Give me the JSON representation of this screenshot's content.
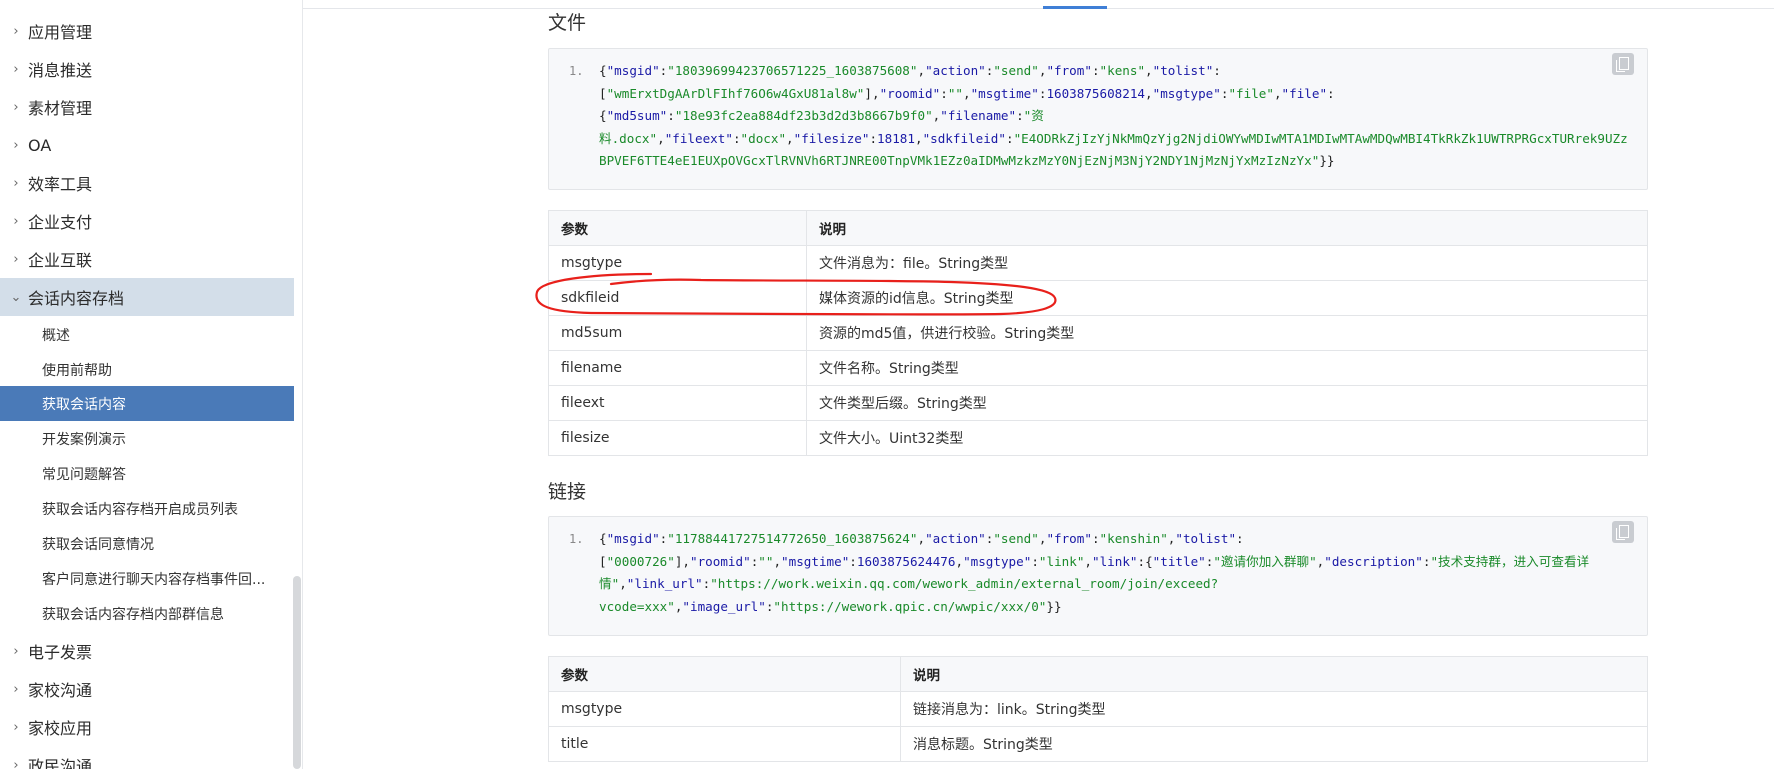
{
  "sidebar": {
    "top_items": [
      {
        "label": "应用管理"
      },
      {
        "label": "消息推送"
      },
      {
        "label": "素材管理"
      },
      {
        "label": "OA"
      },
      {
        "label": "效率工具"
      },
      {
        "label": "企业支付"
      },
      {
        "label": "企业互联"
      }
    ],
    "expanded_item": {
      "label": "会话内容存档"
    },
    "sub_items": [
      {
        "label": "概述"
      },
      {
        "label": "使用前帮助"
      },
      {
        "label": "获取会话内容"
      },
      {
        "label": "开发案例演示"
      },
      {
        "label": "常见问题解答"
      },
      {
        "label": "获取会话内容存档开启成员列表"
      },
      {
        "label": "获取会话同意情况"
      },
      {
        "label": "客户同意进行聊天内容存档事件回..."
      },
      {
        "label": "获取会话内容存档内部群信息"
      }
    ],
    "bottom_items": [
      {
        "label": "电子发票"
      },
      {
        "label": "家校沟通"
      },
      {
        "label": "家校应用"
      },
      {
        "label": "政民沟通"
      }
    ]
  },
  "file_section": {
    "title": "文件",
    "line_number": "1.",
    "code_segments": [
      {
        "t": "{",
        "c": "p"
      },
      {
        "t": "\"msgid\"",
        "c": "k"
      },
      {
        "t": ":",
        "c": "p"
      },
      {
        "t": "\"18039699423706571225_1603875608\"",
        "c": "s"
      },
      {
        "t": ",",
        "c": "p"
      },
      {
        "t": "\"action\"",
        "c": "k"
      },
      {
        "t": ":",
        "c": "p"
      },
      {
        "t": "\"send\"",
        "c": "s"
      },
      {
        "t": ",",
        "c": "p"
      },
      {
        "t": "\"from\"",
        "c": "k"
      },
      {
        "t": ":",
        "c": "p"
      },
      {
        "t": "\"kens\"",
        "c": "s"
      },
      {
        "t": ",",
        "c": "p"
      },
      {
        "t": "\"tolist\"",
        "c": "k"
      },
      {
        "t": ":\n[",
        "c": "p"
      },
      {
        "t": "\"wmErxtDgAArDlFIhf76O6w4GxU81al8w\"",
        "c": "s"
      },
      {
        "t": "],",
        "c": "p"
      },
      {
        "t": "\"roomid\"",
        "c": "k"
      },
      {
        "t": ":",
        "c": "p"
      },
      {
        "t": "\"\"",
        "c": "s"
      },
      {
        "t": ",",
        "c": "p"
      },
      {
        "t": "\"msgtime\"",
        "c": "k"
      },
      {
        "t": ":",
        "c": "p"
      },
      {
        "t": "1603875608214",
        "c": "n"
      },
      {
        "t": ",",
        "c": "p"
      },
      {
        "t": "\"msgtype\"",
        "c": "k"
      },
      {
        "t": ":",
        "c": "p"
      },
      {
        "t": "\"file\"",
        "c": "s"
      },
      {
        "t": ",",
        "c": "p"
      },
      {
        "t": "\"file\"",
        "c": "k"
      },
      {
        "t": ":\n{",
        "c": "p"
      },
      {
        "t": "\"md5sum\"",
        "c": "k"
      },
      {
        "t": ":",
        "c": "p"
      },
      {
        "t": "\"18e93fc2ea884df23b3d2d3b8667b9f0\"",
        "c": "s"
      },
      {
        "t": ",",
        "c": "p"
      },
      {
        "t": "\"filename\"",
        "c": "k"
      },
      {
        "t": ":",
        "c": "p"
      },
      {
        "t": "\"资\n料.docx\"",
        "c": "s"
      },
      {
        "t": ",",
        "c": "p"
      },
      {
        "t": "\"fileext\"",
        "c": "k"
      },
      {
        "t": ":",
        "c": "p"
      },
      {
        "t": "\"docx\"",
        "c": "s"
      },
      {
        "t": ",",
        "c": "p"
      },
      {
        "t": "\"filesize\"",
        "c": "k"
      },
      {
        "t": ":",
        "c": "p"
      },
      {
        "t": "18181",
        "c": "n"
      },
      {
        "t": ",",
        "c": "p"
      },
      {
        "t": "\"sdkfileid\"",
        "c": "k"
      },
      {
        "t": ":",
        "c": "p"
      },
      {
        "t": "\"E4ODRkZjIzYjNkMmQzYjg2NjdiOWYwMDIwMTA1MDIwMTAwMDQwMBI4TkRkZk1UWTRPRGcxTURrek9UZzBPVEF6TTE4eE1EUXpOVGcxTlRVNVh6RTJNRE00TnpVMk1EZz0aIDMwMzkzMzY0NjEzNjM3NjY2NDY1NjMzNjYxMzIzNzYx\"",
        "c": "s"
      },
      {
        "t": "}}",
        "c": "p"
      }
    ],
    "table": {
      "headers": [
        "参数",
        "说明"
      ],
      "rows": [
        [
          "msgtype",
          "文件消息为：file。String类型"
        ],
        [
          "sdkfileid",
          "媒体资源的id信息。String类型"
        ],
        [
          "md5sum",
          "资源的md5值，供进行校验。String类型"
        ],
        [
          "filename",
          "文件名称。String类型"
        ],
        [
          "fileext",
          "文件类型后缀。String类型"
        ],
        [
          "filesize",
          "文件大小。Uint32类型"
        ]
      ]
    }
  },
  "link_section": {
    "title": "链接",
    "line_number": "1.",
    "code_segments": [
      {
        "t": "{",
        "c": "p"
      },
      {
        "t": "\"msgid\"",
        "c": "k"
      },
      {
        "t": ":",
        "c": "p"
      },
      {
        "t": "\"11788441727514772650_1603875624\"",
        "c": "s"
      },
      {
        "t": ",",
        "c": "p"
      },
      {
        "t": "\"action\"",
        "c": "k"
      },
      {
        "t": ":",
        "c": "p"
      },
      {
        "t": "\"send\"",
        "c": "s"
      },
      {
        "t": ",",
        "c": "p"
      },
      {
        "t": "\"from\"",
        "c": "k"
      },
      {
        "t": ":",
        "c": "p"
      },
      {
        "t": "\"kenshin\"",
        "c": "s"
      },
      {
        "t": ",",
        "c": "p"
      },
      {
        "t": "\"tolist\"",
        "c": "k"
      },
      {
        "t": ":\n[",
        "c": "p"
      },
      {
        "t": "\"0000726\"",
        "c": "s"
      },
      {
        "t": "],",
        "c": "p"
      },
      {
        "t": "\"roomid\"",
        "c": "k"
      },
      {
        "t": ":",
        "c": "p"
      },
      {
        "t": "\"\"",
        "c": "s"
      },
      {
        "t": ",",
        "c": "p"
      },
      {
        "t": "\"msgtime\"",
        "c": "k"
      },
      {
        "t": ":",
        "c": "p"
      },
      {
        "t": "1603875624476",
        "c": "n"
      },
      {
        "t": ",",
        "c": "p"
      },
      {
        "t": "\"msgtype\"",
        "c": "k"
      },
      {
        "t": ":",
        "c": "p"
      },
      {
        "t": "\"link\"",
        "c": "s"
      },
      {
        "t": ",",
        "c": "p"
      },
      {
        "t": "\"link\"",
        "c": "k"
      },
      {
        "t": ":{",
        "c": "p"
      },
      {
        "t": "\"title\"",
        "c": "k"
      },
      {
        "t": ":",
        "c": "p"
      },
      {
        "t": "\"邀请你加入群聊\"",
        "c": "s"
      },
      {
        "t": ",",
        "c": "p"
      },
      {
        "t": "\"description\"",
        "c": "k"
      },
      {
        "t": ":",
        "c": "p"
      },
      {
        "t": "\"技术支持群，进入可查看详\n情\"",
        "c": "s"
      },
      {
        "t": ",",
        "c": "p"
      },
      {
        "t": "\"link_url\"",
        "c": "k"
      },
      {
        "t": ":",
        "c": "p"
      },
      {
        "t": "\"https://work.weixin.qq.com/wework_admin/external_room/join/exceed?\nvcode=xxx\"",
        "c": "s"
      },
      {
        "t": ",",
        "c": "p"
      },
      {
        "t": "\"image_url\"",
        "c": "k"
      },
      {
        "t": ":",
        "c": "p"
      },
      {
        "t": "\"https://wework.qpic.cn/wwpic/xxx/0\"",
        "c": "s"
      },
      {
        "t": "}}",
        "c": "p"
      }
    ],
    "table": {
      "headers": [
        "参数",
        "说明"
      ],
      "rows": [
        [
          "msgtype",
          "链接消息为：link。String类型"
        ],
        [
          "title",
          "消息标题。String类型"
        ]
      ]
    }
  },
  "colors": {
    "accent": "#3f7fd6",
    "selected_nav": "#4a7ab8",
    "annotation": "#e8201b"
  }
}
